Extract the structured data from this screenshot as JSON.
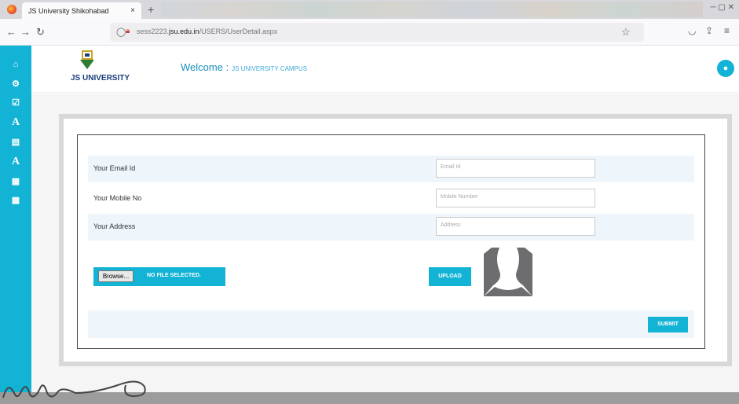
{
  "browser": {
    "tab_title": "JS University Shikohabad",
    "tab_close": "×",
    "new_tab": "+",
    "url_domain_prefix": "sess2223.",
    "url_domain": "jsu.edu.in",
    "url_path": "/USERS/UserDetail.aspx"
  },
  "header": {
    "logo_text": "JS UNIVERSITY",
    "welcome_label": "Welcome :",
    "campus_name": "JS UNIVERSITY CAMPUS"
  },
  "form": {
    "rows": [
      {
        "label": "Your Email Id",
        "placeholder": "Email Id"
      },
      {
        "label": "Your Mobile No",
        "placeholder": "Mobile Number"
      },
      {
        "label": "Your Address",
        "placeholder": "Address"
      }
    ],
    "browse_label": "Browse...",
    "no_file_label": "NO FILE SELECTED.",
    "upload_label": "UPLOAD",
    "submit_label": "SUBMIT"
  },
  "sidebar": {
    "icons": [
      "home-icon",
      "settings-icon",
      "checkbox-icon",
      "font-icon",
      "document-icon",
      "font-icon",
      "chart-icon",
      "chart-icon"
    ]
  },
  "colors": {
    "accent": "#12b3d5",
    "row_alt": "#eef5fb"
  }
}
